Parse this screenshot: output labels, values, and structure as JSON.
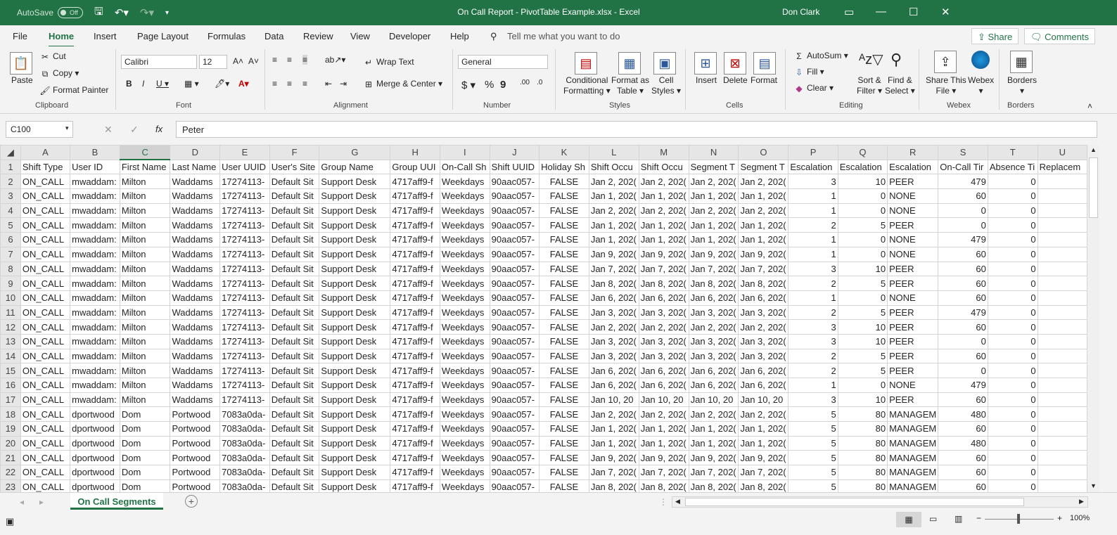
{
  "titlebar": {
    "autosave_label": "AutoSave",
    "autosave_state": "Off",
    "title": "On Call Report - PivotTable Example.xlsx  -  Excel",
    "user": "Don Clark"
  },
  "menu": {
    "tabs": [
      "File",
      "Home",
      "Insert",
      "Page Layout",
      "Formulas",
      "Data",
      "Review",
      "View",
      "Developer",
      "Help"
    ],
    "active_tab": "Home",
    "tell_me": "Tell me what you want to do",
    "share": "Share",
    "comments": "Comments"
  },
  "ribbon": {
    "clipboard": {
      "paste": "Paste",
      "cut": "Cut",
      "copy": "Copy",
      "format_painter": "Format Painter",
      "label": "Clipboard"
    },
    "font": {
      "name": "Calibri",
      "size": "12",
      "label": "Font"
    },
    "alignment": {
      "wrap": "Wrap Text",
      "merge": "Merge & Center",
      "label": "Alignment"
    },
    "number": {
      "format": "General",
      "label": "Number"
    },
    "styles": {
      "conditional": "Conditional",
      "conditional2": "Formatting",
      "format_table": "Format as",
      "format_table2": "Table",
      "cell_styles": "Cell",
      "cell_styles2": "Styles",
      "label": "Styles"
    },
    "cells": {
      "insert": "Insert",
      "delete": "Delete",
      "format": "Format",
      "label": "Cells"
    },
    "editing": {
      "autosum": "AutoSum",
      "fill": "Fill",
      "clear": "Clear",
      "sort": "Sort &",
      "sort2": "Filter",
      "find": "Find &",
      "find2": "Select",
      "label": "Editing"
    },
    "webex": {
      "share": "Share This",
      "share2": "File",
      "webex": "Webex",
      "label": "Webex"
    },
    "borders": {
      "borders": "Borders",
      "label": "Borders"
    }
  },
  "formula_bar": {
    "name_box": "C100",
    "value": "Peter"
  },
  "columns": [
    "A",
    "B",
    "C",
    "D",
    "E",
    "F",
    "G",
    "H",
    "I",
    "J",
    "K",
    "L",
    "M",
    "N",
    "O",
    "P",
    "Q",
    "R",
    "S",
    "T",
    "U"
  ],
  "selected_column": "C",
  "header_row": [
    "Shift Type",
    "User ID",
    "First Name",
    "Last Name",
    "User UUID",
    "User's Site",
    "Group Name",
    "Group UUI",
    "On-Call Sh",
    "Shift UUID",
    "Holiday Sh",
    "Shift Occu",
    "Shift Occu",
    "Segment T",
    "Segment T",
    "Escalation",
    "Escalation",
    "Escalation",
    "On-Call Tir",
    "Absence Ti",
    "Replacem"
  ],
  "rows": [
    [
      "2",
      "ON_CALL",
      "mwaddam:",
      "Milton",
      "Waddams",
      "17274113-",
      "Default Sit",
      "Support Desk",
      "4717aff9-f",
      "Weekdays",
      "90aac057-",
      "FALSE",
      "Jan 2, 202(",
      "Jan 2, 202(",
      "Jan 2, 202(",
      "Jan 2, 202(",
      "3",
      "10",
      "PEER",
      "479",
      "0",
      ""
    ],
    [
      "3",
      "ON_CALL",
      "mwaddam:",
      "Milton",
      "Waddams",
      "17274113-",
      "Default Sit",
      "Support Desk",
      "4717aff9-f",
      "Weekdays",
      "90aac057-",
      "FALSE",
      "Jan 1, 202(",
      "Jan 1, 202(",
      "Jan 1, 202(",
      "Jan 1, 202(",
      "1",
      "0",
      "NONE",
      "60",
      "0",
      ""
    ],
    [
      "4",
      "ON_CALL",
      "mwaddam:",
      "Milton",
      "Waddams",
      "17274113-",
      "Default Sit",
      "Support Desk",
      "4717aff9-f",
      "Weekdays",
      "90aac057-",
      "FALSE",
      "Jan 2, 202(",
      "Jan 2, 202(",
      "Jan 2, 202(",
      "Jan 2, 202(",
      "1",
      "0",
      "NONE",
      "0",
      "0",
      ""
    ],
    [
      "5",
      "ON_CALL",
      "mwaddam:",
      "Milton",
      "Waddams",
      "17274113-",
      "Default Sit",
      "Support Desk",
      "4717aff9-f",
      "Weekdays",
      "90aac057-",
      "FALSE",
      "Jan 1, 202(",
      "Jan 1, 202(",
      "Jan 1, 202(",
      "Jan 1, 202(",
      "2",
      "5",
      "PEER",
      "0",
      "0",
      ""
    ],
    [
      "6",
      "ON_CALL",
      "mwaddam:",
      "Milton",
      "Waddams",
      "17274113-",
      "Default Sit",
      "Support Desk",
      "4717aff9-f",
      "Weekdays",
      "90aac057-",
      "FALSE",
      "Jan 1, 202(",
      "Jan 1, 202(",
      "Jan 1, 202(",
      "Jan 1, 202(",
      "1",
      "0",
      "NONE",
      "479",
      "0",
      ""
    ],
    [
      "7",
      "ON_CALL",
      "mwaddam:",
      "Milton",
      "Waddams",
      "17274113-",
      "Default Sit",
      "Support Desk",
      "4717aff9-f",
      "Weekdays",
      "90aac057-",
      "FALSE",
      "Jan 9, 202(",
      "Jan 9, 202(",
      "Jan 9, 202(",
      "Jan 9, 202(",
      "1",
      "0",
      "NONE",
      "60",
      "0",
      ""
    ],
    [
      "8",
      "ON_CALL",
      "mwaddam:",
      "Milton",
      "Waddams",
      "17274113-",
      "Default Sit",
      "Support Desk",
      "4717aff9-f",
      "Weekdays",
      "90aac057-",
      "FALSE",
      "Jan 7, 202(",
      "Jan 7, 202(",
      "Jan 7, 202(",
      "Jan 7, 202(",
      "3",
      "10",
      "PEER",
      "60",
      "0",
      ""
    ],
    [
      "9",
      "ON_CALL",
      "mwaddam:",
      "Milton",
      "Waddams",
      "17274113-",
      "Default Sit",
      "Support Desk",
      "4717aff9-f",
      "Weekdays",
      "90aac057-",
      "FALSE",
      "Jan 8, 202(",
      "Jan 8, 202(",
      "Jan 8, 202(",
      "Jan 8, 202(",
      "2",
      "5",
      "PEER",
      "60",
      "0",
      ""
    ],
    [
      "10",
      "ON_CALL",
      "mwaddam:",
      "Milton",
      "Waddams",
      "17274113-",
      "Default Sit",
      "Support Desk",
      "4717aff9-f",
      "Weekdays",
      "90aac057-",
      "FALSE",
      "Jan 6, 202(",
      "Jan 6, 202(",
      "Jan 6, 202(",
      "Jan 6, 202(",
      "1",
      "0",
      "NONE",
      "60",
      "0",
      ""
    ],
    [
      "11",
      "ON_CALL",
      "mwaddam:",
      "Milton",
      "Waddams",
      "17274113-",
      "Default Sit",
      "Support Desk",
      "4717aff9-f",
      "Weekdays",
      "90aac057-",
      "FALSE",
      "Jan 3, 202(",
      "Jan 3, 202(",
      "Jan 3, 202(",
      "Jan 3, 202(",
      "2",
      "5",
      "PEER",
      "479",
      "0",
      ""
    ],
    [
      "12",
      "ON_CALL",
      "mwaddam:",
      "Milton",
      "Waddams",
      "17274113-",
      "Default Sit",
      "Support Desk",
      "4717aff9-f",
      "Weekdays",
      "90aac057-",
      "FALSE",
      "Jan 2, 202(",
      "Jan 2, 202(",
      "Jan 2, 202(",
      "Jan 2, 202(",
      "3",
      "10",
      "PEER",
      "60",
      "0",
      ""
    ],
    [
      "13",
      "ON_CALL",
      "mwaddam:",
      "Milton",
      "Waddams",
      "17274113-",
      "Default Sit",
      "Support Desk",
      "4717aff9-f",
      "Weekdays",
      "90aac057-",
      "FALSE",
      "Jan 3, 202(",
      "Jan 3, 202(",
      "Jan 3, 202(",
      "Jan 3, 202(",
      "3",
      "10",
      "PEER",
      "0",
      "0",
      ""
    ],
    [
      "14",
      "ON_CALL",
      "mwaddam:",
      "Milton",
      "Waddams",
      "17274113-",
      "Default Sit",
      "Support Desk",
      "4717aff9-f",
      "Weekdays",
      "90aac057-",
      "FALSE",
      "Jan 3, 202(",
      "Jan 3, 202(",
      "Jan 3, 202(",
      "Jan 3, 202(",
      "2",
      "5",
      "PEER",
      "60",
      "0",
      ""
    ],
    [
      "15",
      "ON_CALL",
      "mwaddam:",
      "Milton",
      "Waddams",
      "17274113-",
      "Default Sit",
      "Support Desk",
      "4717aff9-f",
      "Weekdays",
      "90aac057-",
      "FALSE",
      "Jan 6, 202(",
      "Jan 6, 202(",
      "Jan 6, 202(",
      "Jan 6, 202(",
      "2",
      "5",
      "PEER",
      "0",
      "0",
      ""
    ],
    [
      "16",
      "ON_CALL",
      "mwaddam:",
      "Milton",
      "Waddams",
      "17274113-",
      "Default Sit",
      "Support Desk",
      "4717aff9-f",
      "Weekdays",
      "90aac057-",
      "FALSE",
      "Jan 6, 202(",
      "Jan 6, 202(",
      "Jan 6, 202(",
      "Jan 6, 202(",
      "1",
      "0",
      "NONE",
      "479",
      "0",
      ""
    ],
    [
      "17",
      "ON_CALL",
      "mwaddam:",
      "Milton",
      "Waddams",
      "17274113-",
      "Default Sit",
      "Support Desk",
      "4717aff9-f",
      "Weekdays",
      "90aac057-",
      "FALSE",
      "Jan 10, 20",
      "Jan 10, 20",
      "Jan 10, 20",
      "Jan 10, 20",
      "3",
      "10",
      "PEER",
      "60",
      "0",
      ""
    ],
    [
      "18",
      "ON_CALL",
      "dportwood",
      "Dom",
      "Portwood",
      "7083a0da-",
      "Default Sit",
      "Support Desk",
      "4717aff9-f",
      "Weekdays",
      "90aac057-",
      "FALSE",
      "Jan 2, 202(",
      "Jan 2, 202(",
      "Jan 2, 202(",
      "Jan 2, 202(",
      "5",
      "80",
      "MANAGEM",
      "480",
      "0",
      ""
    ],
    [
      "19",
      "ON_CALL",
      "dportwood",
      "Dom",
      "Portwood",
      "7083a0da-",
      "Default Sit",
      "Support Desk",
      "4717aff9-f",
      "Weekdays",
      "90aac057-",
      "FALSE",
      "Jan 1, 202(",
      "Jan 1, 202(",
      "Jan 1, 202(",
      "Jan 1, 202(",
      "5",
      "80",
      "MANAGEM",
      "60",
      "0",
      ""
    ],
    [
      "20",
      "ON_CALL",
      "dportwood",
      "Dom",
      "Portwood",
      "7083a0da-",
      "Default Sit",
      "Support Desk",
      "4717aff9-f",
      "Weekdays",
      "90aac057-",
      "FALSE",
      "Jan 1, 202(",
      "Jan 1, 202(",
      "Jan 1, 202(",
      "Jan 1, 202(",
      "5",
      "80",
      "MANAGEM",
      "480",
      "0",
      ""
    ],
    [
      "21",
      "ON_CALL",
      "dportwood",
      "Dom",
      "Portwood",
      "7083a0da-",
      "Default Sit",
      "Support Desk",
      "4717aff9-f",
      "Weekdays",
      "90aac057-",
      "FALSE",
      "Jan 9, 202(",
      "Jan 9, 202(",
      "Jan 9, 202(",
      "Jan 9, 202(",
      "5",
      "80",
      "MANAGEM",
      "60",
      "0",
      ""
    ],
    [
      "22",
      "ON_CALL",
      "dportwood",
      "Dom",
      "Portwood",
      "7083a0da-",
      "Default Sit",
      "Support Desk",
      "4717aff9-f",
      "Weekdays",
      "90aac057-",
      "FALSE",
      "Jan 7, 202(",
      "Jan 7, 202(",
      "Jan 7, 202(",
      "Jan 7, 202(",
      "5",
      "80",
      "MANAGEM",
      "60",
      "0",
      ""
    ],
    [
      "23",
      "ON_CALL",
      "dportwood",
      "Dom",
      "Portwood",
      "7083a0da-",
      "Default Sit",
      "Support Desk",
      "4717aff9-f",
      "Weekdays",
      "90aac057-",
      "FALSE",
      "Jan 8, 202(",
      "Jan 8, 202(",
      "Jan 8, 202(",
      "Jan 8, 202(",
      "5",
      "80",
      "MANAGEM",
      "60",
      "0",
      ""
    ]
  ],
  "sheet_tab": "On Call Segments",
  "status": {
    "zoom": "100%"
  },
  "colors": {
    "accent": "#217346"
  }
}
